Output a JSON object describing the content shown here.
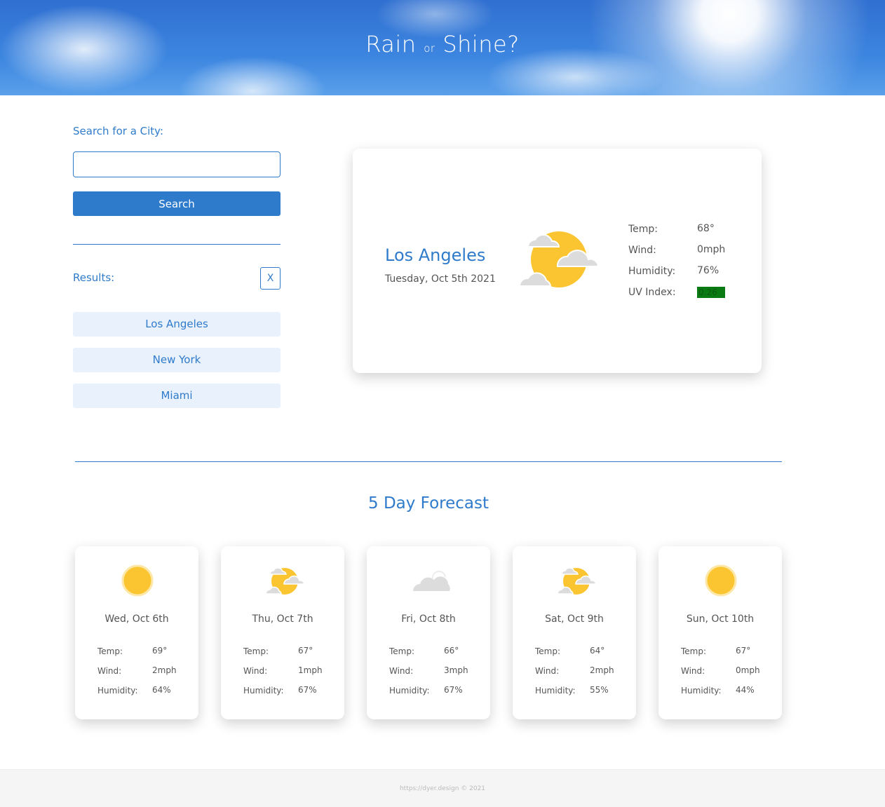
{
  "header": {
    "title_left": "Rain",
    "title_mid": "or",
    "title_right": "Shine?"
  },
  "sidebar": {
    "search_label": "Search for a City:",
    "search_value": "",
    "search_button": "Search",
    "results_label": "Results:",
    "clear_button": "X",
    "results": [
      {
        "label": "Los Angeles"
      },
      {
        "label": "New York"
      },
      {
        "label": "Miami"
      }
    ]
  },
  "current": {
    "city": "Los Angeles",
    "date": "Tuesday, Oct 5th 2021",
    "icon": "partly-cloudy-icon",
    "labels": {
      "temp": "Temp:",
      "wind": "Wind:",
      "humidity": "Humidity:",
      "uv": "UV Index:"
    },
    "temp": "68°",
    "wind": "0mph",
    "humidity": "76%",
    "uv_index": "0.26",
    "uv_color": "#0a7a12"
  },
  "forecast": {
    "title": "5 Day Forecast",
    "labels": {
      "temp": "Temp:",
      "wind": "Wind:",
      "humidity": "Humidity:"
    },
    "days": [
      {
        "date": "Wed, Oct 6th",
        "icon": "sun-icon",
        "temp": "69°",
        "wind": "2mph",
        "humidity": "64%"
      },
      {
        "date": "Thu, Oct 7th",
        "icon": "partly-cloudy-icon",
        "temp": "67°",
        "wind": "1mph",
        "humidity": "67%"
      },
      {
        "date": "Fri, Oct 8th",
        "icon": "cloud-icon",
        "temp": "66°",
        "wind": "3mph",
        "humidity": "67%"
      },
      {
        "date": "Sat, Oct 9th",
        "icon": "partly-cloudy-icon",
        "temp": "64°",
        "wind": "2mph",
        "humidity": "55%"
      },
      {
        "date": "Sun, Oct 10th",
        "icon": "sun-icon",
        "temp": "67°",
        "wind": "0mph",
        "humidity": "44%"
      }
    ]
  },
  "footer": {
    "text": "https://dyer.design © 2021"
  },
  "colors": {
    "accent": "#2f7bcb",
    "result_bg": "#e8f1fc",
    "sun": "#fbc531",
    "cloud": "#dcdcdc"
  }
}
